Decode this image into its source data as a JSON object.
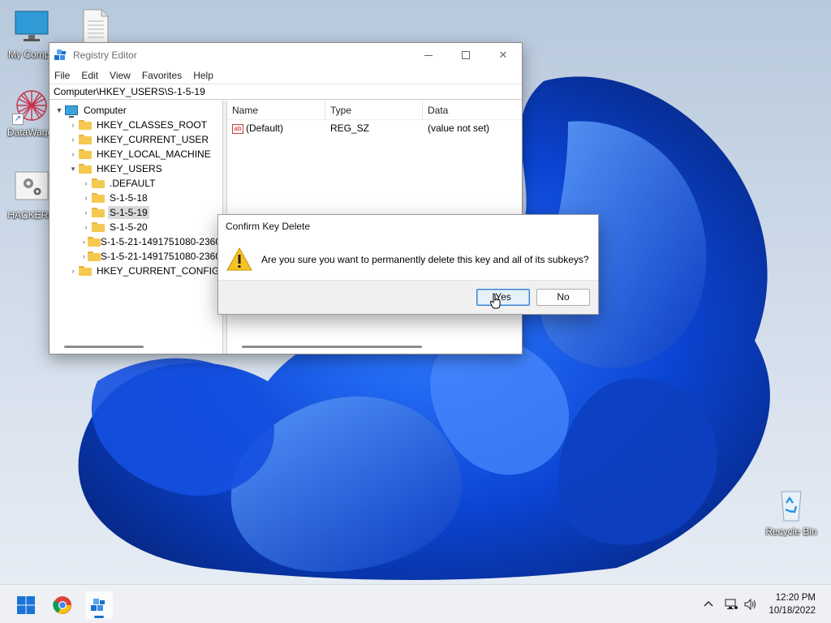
{
  "desktop": {
    "icons": [
      {
        "label": "My Compu"
      },
      {
        "label": ""
      },
      {
        "label": "DataWagor"
      },
      {
        "label": "HACKERib"
      },
      {
        "label": "Recycle Bin"
      }
    ]
  },
  "regedit": {
    "title": "Registry Editor",
    "menu": [
      "File",
      "Edit",
      "View",
      "Favorites",
      "Help"
    ],
    "address": "Computer\\HKEY_USERS\\S-1-5-19",
    "tree": [
      {
        "label": "Computer",
        "depth": 0,
        "expanded": true,
        "icon": "computer-icon"
      },
      {
        "label": "HKEY_CLASSES_ROOT",
        "depth": 1,
        "expanded": false
      },
      {
        "label": "HKEY_CURRENT_USER",
        "depth": 1,
        "expanded": false
      },
      {
        "label": "HKEY_LOCAL_MACHINE",
        "depth": 1,
        "expanded": false
      },
      {
        "label": "HKEY_USERS",
        "depth": 1,
        "expanded": true
      },
      {
        "label": ".DEFAULT",
        "depth": 2,
        "expanded": false
      },
      {
        "label": "S-1-5-18",
        "depth": 2,
        "expanded": false
      },
      {
        "label": "S-1-5-19",
        "depth": 2,
        "expanded": false,
        "selected": true
      },
      {
        "label": "S-1-5-20",
        "depth": 2,
        "expanded": false
      },
      {
        "label": "S-1-5-21-1491751080-2360",
        "depth": 2,
        "expanded": false
      },
      {
        "label": "S-1-5-21-1491751080-2360",
        "depth": 2,
        "expanded": false
      },
      {
        "label": "HKEY_CURRENT_CONFIG",
        "depth": 1,
        "expanded": false
      }
    ],
    "columns": {
      "name": "Name",
      "type": "Type",
      "data": "Data"
    },
    "values": [
      {
        "name": "(Default)",
        "type": "REG_SZ",
        "data": "(value not set)",
        "icon_text": "ab"
      }
    ]
  },
  "dialog": {
    "title": "Confirm Key Delete",
    "message": "Are you sure you want to permanently delete this key and all of its subkeys?",
    "yes_label": "Yes",
    "no_label": "No"
  },
  "taskbar": {
    "apps": [
      "start-icon",
      "chrome-icon",
      "regedit-icon"
    ],
    "tray": {
      "chevron": "^",
      "time": "12:20 PM",
      "date": "10/18/2022"
    }
  },
  "colors": {
    "accent": "#1c6fd0",
    "wallpaper": "#1a56d6",
    "folder": "#f5c950"
  }
}
